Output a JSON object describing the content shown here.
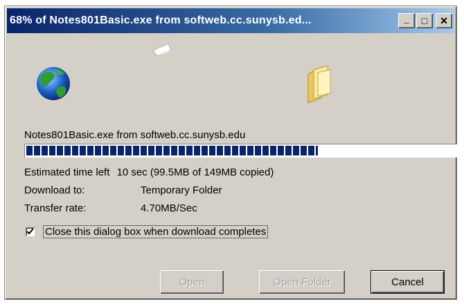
{
  "window": {
    "title": "68% of Notes801Basic.exe from softweb.cc.sunysb.ed...",
    "controls": {
      "minimize": "_",
      "maximize": "□",
      "close": "×"
    }
  },
  "animation": {
    "source_icon": "globe-icon",
    "moving_icon": "flying-document-icon",
    "target_icon": "folder-icon"
  },
  "download": {
    "file_line": "Notes801Basic.exe from softweb.cc.sunysb.edu",
    "progress_percent": 68,
    "estimated_label": "Estimated time left",
    "estimated_value": "10 sec (99.5MB of 149MB copied)",
    "download_to_label": "Download to:",
    "download_to_value": "Temporary Folder",
    "transfer_rate_label": "Transfer rate:",
    "transfer_rate_value": "4.70MB/Sec"
  },
  "close_checkbox": {
    "checked": true,
    "label": "Close this dialog box when download completes"
  },
  "buttons": {
    "open": "Open",
    "open_folder": "Open Folder",
    "cancel": "Cancel"
  }
}
